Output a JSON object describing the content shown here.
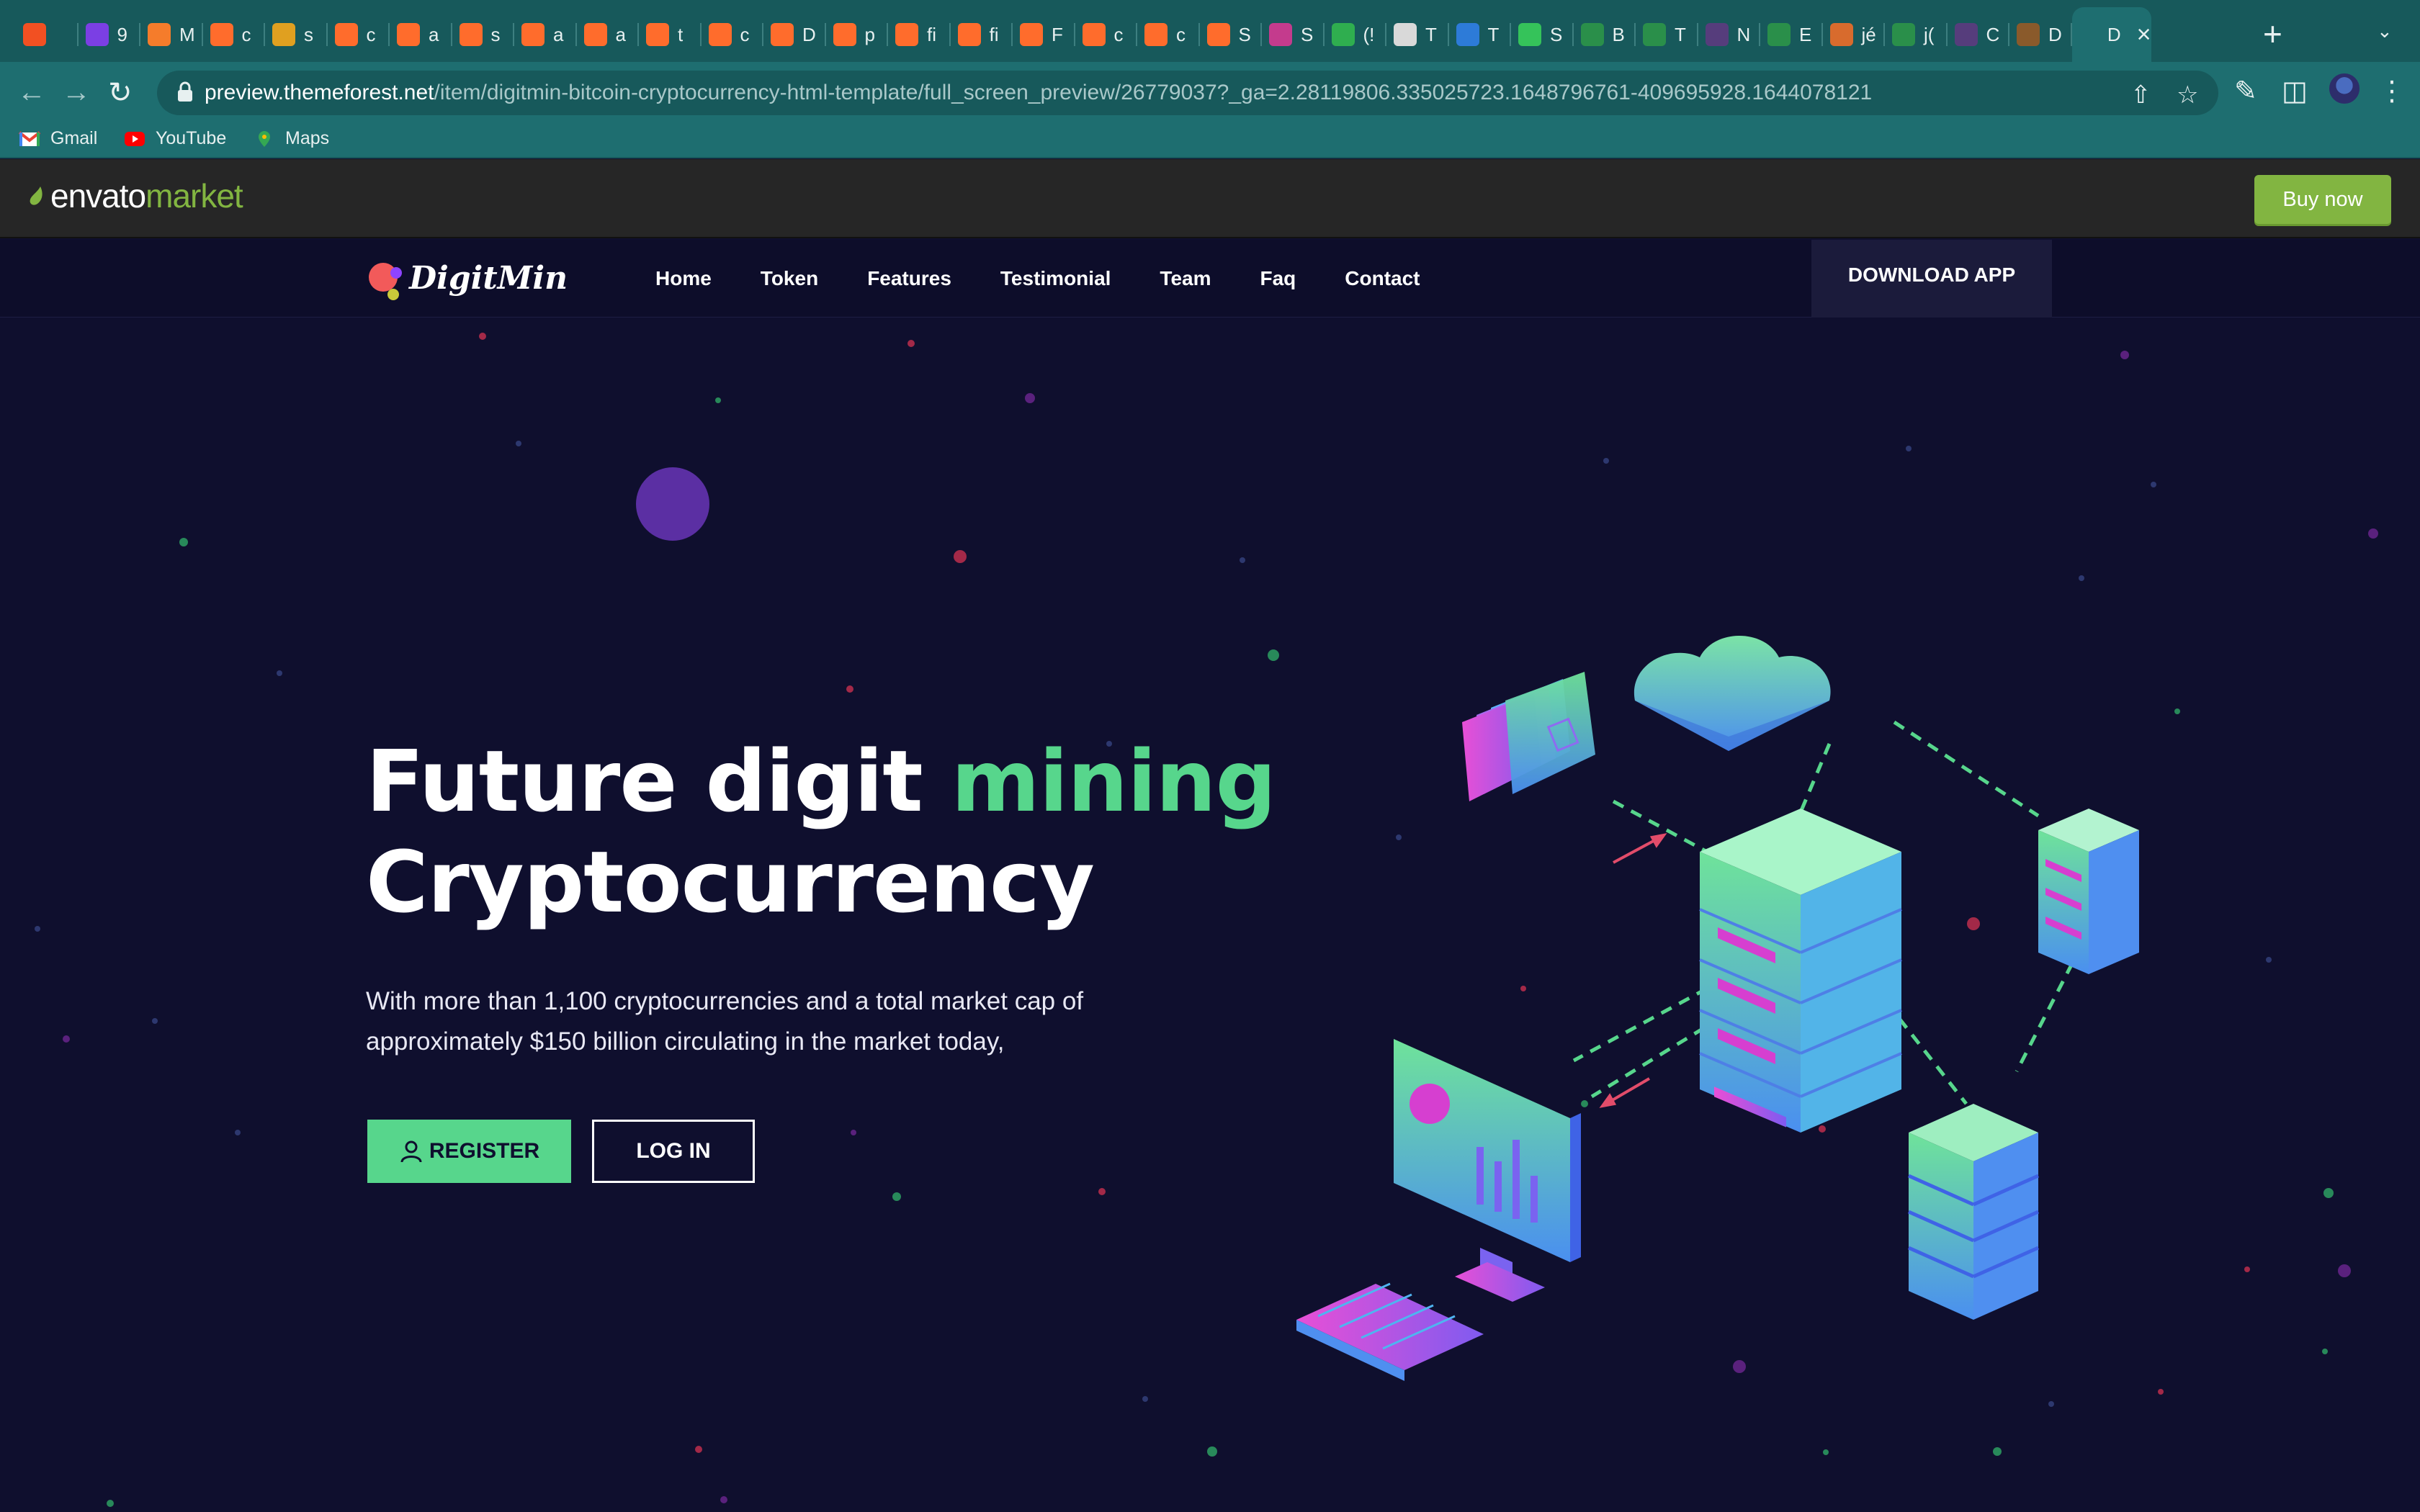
{
  "browser": {
    "tabs": [
      {
        "icon": "windows-icon",
        "label": "",
        "color": "#f25022"
      },
      {
        "icon": "play-icon",
        "label": "9",
        "color": "#7b3fe4"
      },
      {
        "icon": "chart-icon",
        "label": "M",
        "color": "#f57c2b"
      },
      {
        "icon": "cpanel-icon",
        "label": "c",
        "color": "#ff6c2c"
      },
      {
        "icon": "tent-icon",
        "label": "s",
        "color": "#e0a020"
      },
      {
        "icon": "cpanel-icon",
        "label": "c",
        "color": "#ff6c2c"
      },
      {
        "icon": "cpanel-icon",
        "label": "a",
        "color": "#ff6c2c"
      },
      {
        "icon": "cpanel-icon",
        "label": "s",
        "color": "#ff6c2c"
      },
      {
        "icon": "cpanel-icon",
        "label": "a",
        "color": "#ff6c2c"
      },
      {
        "icon": "cpanel-icon",
        "label": "a",
        "color": "#ff6c2c"
      },
      {
        "icon": "cpanel-icon",
        "label": "t",
        "color": "#ff6c2c"
      },
      {
        "icon": "cpanel-icon",
        "label": "c",
        "color": "#ff6c2c"
      },
      {
        "icon": "cpanel-icon",
        "label": "D",
        "color": "#ff6c2c"
      },
      {
        "icon": "cpanel-icon",
        "label": "p",
        "color": "#ff6c2c"
      },
      {
        "icon": "cpanel-icon",
        "label": "fi",
        "color": "#ff6c2c"
      },
      {
        "icon": "cpanel-icon",
        "label": "fi",
        "color": "#ff6c2c"
      },
      {
        "icon": "cpanel-icon",
        "label": "F",
        "color": "#ff6c2c"
      },
      {
        "icon": "cpanel-icon",
        "label": "c",
        "color": "#ff6c2c"
      },
      {
        "icon": "cpanel-icon",
        "label": "c",
        "color": "#ff6c2c"
      },
      {
        "icon": "cpanel-icon",
        "label": "S",
        "color": "#ff6c2c"
      },
      {
        "icon": "stripes-icon",
        "label": "S",
        "color": "#c43b8d"
      },
      {
        "icon": "badge-icon",
        "label": "(!",
        "color": "#2fae4f"
      },
      {
        "icon": "doc-icon",
        "label": "T",
        "color": "#d9d9d9"
      },
      {
        "icon": "shield-icon",
        "label": "T",
        "color": "#2d7bd8"
      },
      {
        "icon": "dot-icon",
        "label": "S",
        "color": "#35c35a"
      },
      {
        "icon": "w-icon",
        "label": "B",
        "color": "#2a8f4a"
      },
      {
        "icon": "w-icon",
        "label": "T",
        "color": "#2a8f4a"
      },
      {
        "icon": "b-icon",
        "label": "N",
        "color": "#563d7c"
      },
      {
        "icon": "w-icon",
        "label": "E",
        "color": "#2a8f4a"
      },
      {
        "icon": "flame-icon",
        "label": "jé",
        "color": "#d86b2d"
      },
      {
        "icon": "w-icon",
        "label": "j(",
        "color": "#2a8f4a"
      },
      {
        "icon": "b-icon",
        "label": "C",
        "color": "#563d7c"
      },
      {
        "icon": "book-icon",
        "label": "D",
        "color": "#8a5a2b"
      },
      {
        "icon": "digitmin-icon",
        "label": "D",
        "color": "#1e6e70"
      }
    ],
    "url_host": "preview.themeforest.net",
    "url_path": "/item/digitmin-bitcoin-cryptocurrency-html-template/full_screen_preview/26779037?_ga=2.28119806.335025723.1648796761-409695928.1644078121",
    "bookmarks": [
      {
        "label": "Gmail",
        "icon": "gmail-icon"
      },
      {
        "label": "YouTube",
        "icon": "youtube-icon"
      },
      {
        "label": "Maps",
        "icon": "maps-icon"
      }
    ]
  },
  "envato": {
    "logo_word": "envato",
    "logo_market": "market",
    "buy_label": "Buy now"
  },
  "site": {
    "brand": "DigitMin",
    "nav": [
      "Home",
      "Token",
      "Features",
      "Testimonial",
      "Team",
      "Faq",
      "Contact"
    ],
    "download_label": "DOWNLOAD APP",
    "hero": {
      "title_part1": "Future digit ",
      "title_accent": "mining",
      "title_line2": "Cryptocurrency",
      "subtitle": "With more than 1,100 cryptocurrencies and a total market cap of approximately $150 billion circulating in the market today,",
      "register_label": "REGISTER",
      "login_label": "LOG IN"
    }
  },
  "colors": {
    "accent_green": "#57d68c",
    "page_bg": "#0f0f2e",
    "chrome_teal": "#1e6e70",
    "envato_green": "#82b541"
  }
}
